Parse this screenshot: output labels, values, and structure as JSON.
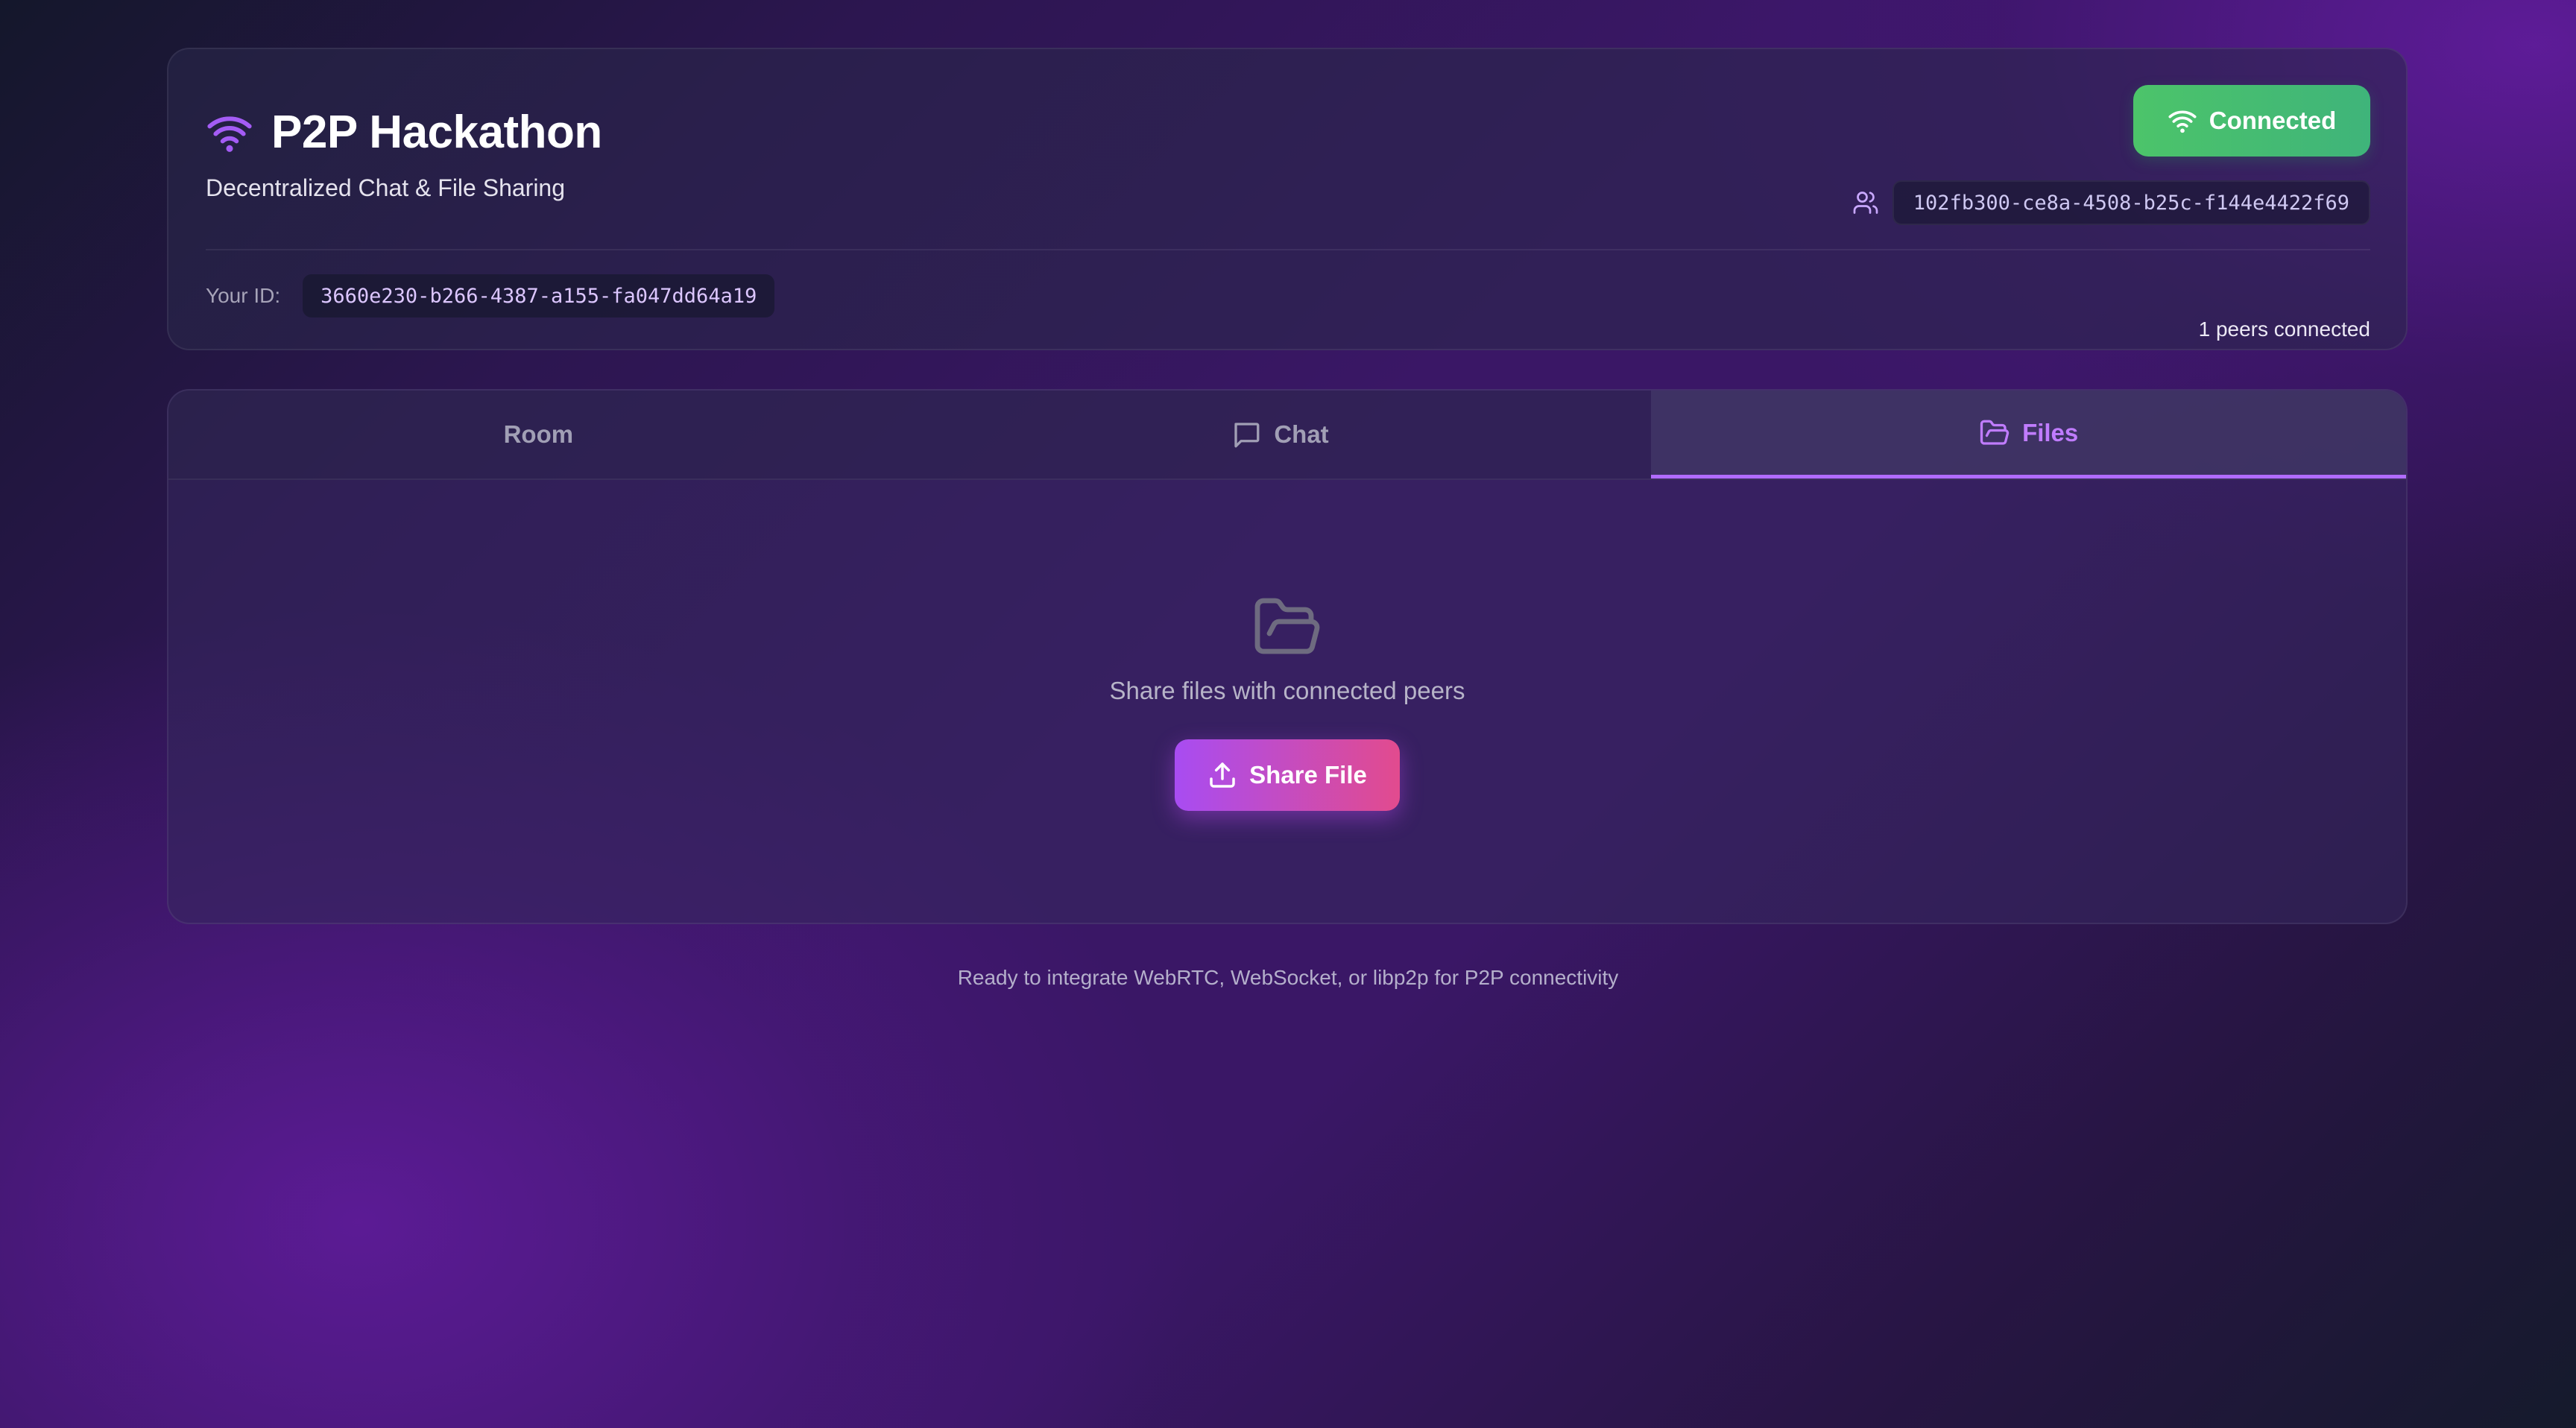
{
  "header": {
    "title": "P2P Hackathon",
    "subtitle": "Decentralized Chat & File Sharing",
    "brand_icon": "wifi-icon",
    "status_label": "Connected",
    "status_icon": "wifi-icon",
    "peer_icon": "users-icon",
    "peer_id": "102fb300-ce8a-4508-b25c-f144e4422f69",
    "your_id_label": "Your ID:",
    "your_id": "3660e230-b266-4387-a155-fa047dd64a19",
    "peers_connected": "1 peers connected"
  },
  "tabs": [
    {
      "label": "Room",
      "icon": "",
      "active": false
    },
    {
      "label": "Chat",
      "icon": "chat-bubble-icon",
      "active": false
    },
    {
      "label": "Files",
      "icon": "folder-open-icon",
      "active": true
    }
  ],
  "files": {
    "empty_icon": "folder-open-icon",
    "empty_text": "Share files with connected peers",
    "share_label": "Share File",
    "share_icon": "upload-icon"
  },
  "footer": {
    "note": "Ready to integrate WebRTC, WebSocket, or libp2p for P2P connectivity"
  },
  "colors": {
    "accent_purple": "#b06cff",
    "connected_green": "#4cc46a",
    "share_gradient_start": "#a84cf2",
    "share_gradient_end": "#e24b8e"
  }
}
